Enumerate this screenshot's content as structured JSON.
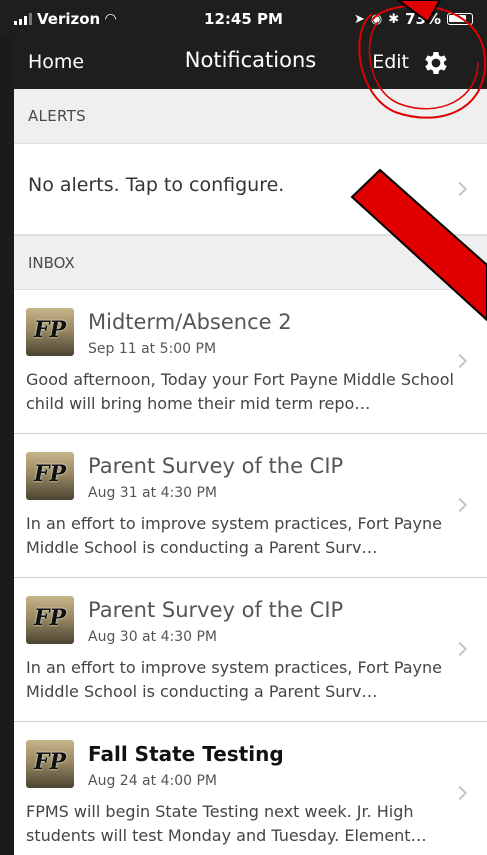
{
  "status_bar": {
    "carrier": "Verizon",
    "time": "12:45 PM",
    "battery": "73%"
  },
  "nav": {
    "back_label": "Home",
    "title": "Notifications",
    "edit_label": "Edit",
    "settings_icon": "gear-icon"
  },
  "alerts": {
    "header": "ALERTS",
    "empty_text": "No alerts. Tap to configure."
  },
  "inbox": {
    "header": "INBOX",
    "messages": [
      {
        "logo_text": "FP",
        "title": "Midterm/Absence 2",
        "date": "Sep 11 at 5:00 PM",
        "preview": "Good afternoon,  Today your Fort Payne Middle School child will bring home their mid term repo…",
        "unread": false
      },
      {
        "logo_text": "FP",
        "title": "Parent Survey of the CIP",
        "date": "Aug 31 at 4:30 PM",
        "preview": "In an effort to improve system practices, Fort Payne Middle School is conducting a Parent Surv…",
        "unread": false
      },
      {
        "logo_text": "FP",
        "title": "Parent Survey of the CIP",
        "date": "Aug 30 at 4:30 PM",
        "preview": "In an effort to improve system practices, Fort Payne Middle School is conducting a Parent Surv…",
        "unread": false
      },
      {
        "logo_text": "FP",
        "title": "Fall State Testing",
        "date": "Aug 24 at 4:00 PM",
        "preview": "FPMS will begin State Testing next week. Jr. High students will test Monday and Tuesday. Element…",
        "unread": true
      }
    ]
  },
  "colors": {
    "nav_bg": "#1e1e1e",
    "annotation_red": "#e00000"
  }
}
